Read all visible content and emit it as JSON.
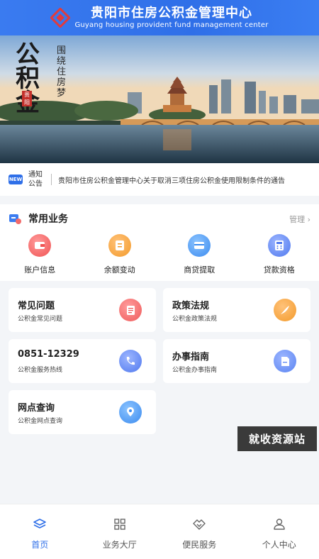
{
  "header": {
    "title_cn": "贵阳市住房公积金管理中心",
    "title_en": "Guyang housing provident fund management center",
    "logo_icon": "provident-fund-logo-icon"
  },
  "banner": {
    "calligraphy": "公积金",
    "slogan": "围绕住房梦",
    "seal": "贵阳"
  },
  "notice": {
    "badge": "NEW",
    "label": "通知公告",
    "text": "贵阳市住房公积金管理中心关于取消三项住房公积金使用限制条件的通告"
  },
  "common": {
    "title": "常用业务",
    "manage": "管理",
    "items": [
      {
        "label": "账户信息",
        "icon": "wallet-icon",
        "color": "#f26b6b"
      },
      {
        "label": "余额变动",
        "icon": "balance-icon",
        "color": "#f5a13b"
      },
      {
        "label": "商贷提取",
        "icon": "card-icon",
        "color": "#4a9bf0"
      },
      {
        "label": "贷款资格",
        "icon": "calculator-icon",
        "color": "#5a84f2"
      }
    ]
  },
  "cards": [
    {
      "title": "常见问题",
      "subtitle": "公积金常见问题",
      "icon": "document-icon",
      "color": "#f26b6b"
    },
    {
      "title": "政策法规",
      "subtitle": "公积金政策法规",
      "icon": "feather-icon",
      "color": "#f5a13b"
    },
    {
      "title": "0851-12329",
      "subtitle": "公积金服务热线",
      "icon": "phone-icon",
      "color": "#5a84f2"
    },
    {
      "title": "办事指南",
      "subtitle": "公积金办事指南",
      "icon": "file-icon",
      "color": "#5a84f2"
    },
    {
      "title": "网点查询",
      "subtitle": "公积金网点查询",
      "icon": "location-icon",
      "color": "#4a9bf0"
    }
  ],
  "watermark": "就收资源站",
  "tabs": [
    {
      "label": "首页",
      "icon": "home-layers-icon",
      "active": true
    },
    {
      "label": "业务大厅",
      "icon": "grid-icon",
      "active": false
    },
    {
      "label": "便民服务",
      "icon": "handshake-icon",
      "active": false
    },
    {
      "label": "个人中心",
      "icon": "person-icon",
      "active": false
    }
  ],
  "colors": {
    "accent": "#2f6fe8",
    "background": "#f3f5f8"
  }
}
